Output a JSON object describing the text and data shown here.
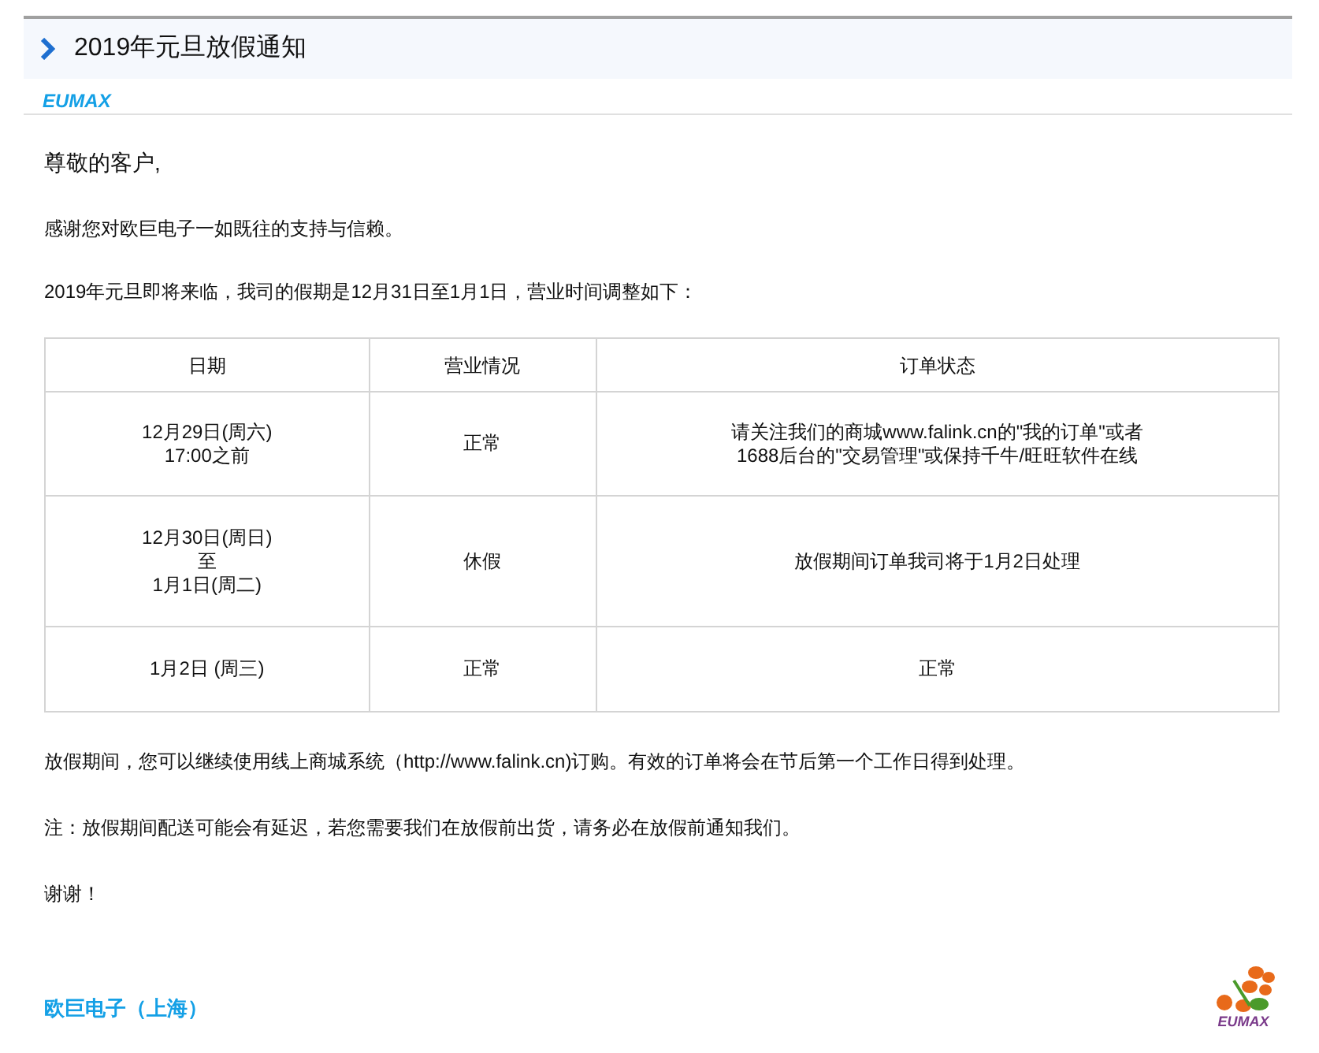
{
  "title": "2019年元旦放假通知",
  "brand": "EUMAX",
  "greeting": "尊敬的客户,",
  "paragraphs": [
    "感谢您对欧巨电子一如既往的支持与信赖。",
    "2019年元旦即将来临，我司的假期是12月31日至1月1日，营业时间调整如下："
  ],
  "table": {
    "columns": [
      "日期",
      "营业情况",
      "订单状态"
    ],
    "rows": [
      {
        "cells": [
          [
            "12月29日(周六)",
            "17:00之前"
          ],
          [
            "正常"
          ],
          [
            "请关注我们的商城www.falink.cn的\"我的订单\"或者",
            "1688后台的\"交易管理\"或保持千牛/旺旺软件在线"
          ]
        ]
      },
      {
        "cells": [
          [
            "12月30日(周日)",
            "至",
            "1月1日(周二)"
          ],
          [
            "休假"
          ],
          [
            "放假期间订单我司将于1月2日处理"
          ]
        ]
      },
      {
        "cells": [
          [
            "1月2日 (周三)"
          ],
          [
            "正常"
          ],
          [
            "正常"
          ]
        ]
      }
    ]
  },
  "notes": [
    "放假期间，您可以继续使用线上商城系统（http://www.falink.cn)订购。有效的订单将会在节后第一个工作日得到处理。",
    "注：放假期间配送可能会有延迟，若您需要我们在放假前出货，请务必在放假前通知我们。",
    "谢谢！"
  ],
  "signature": "欧巨电子（上海）",
  "logo_text": "EUMAX"
}
